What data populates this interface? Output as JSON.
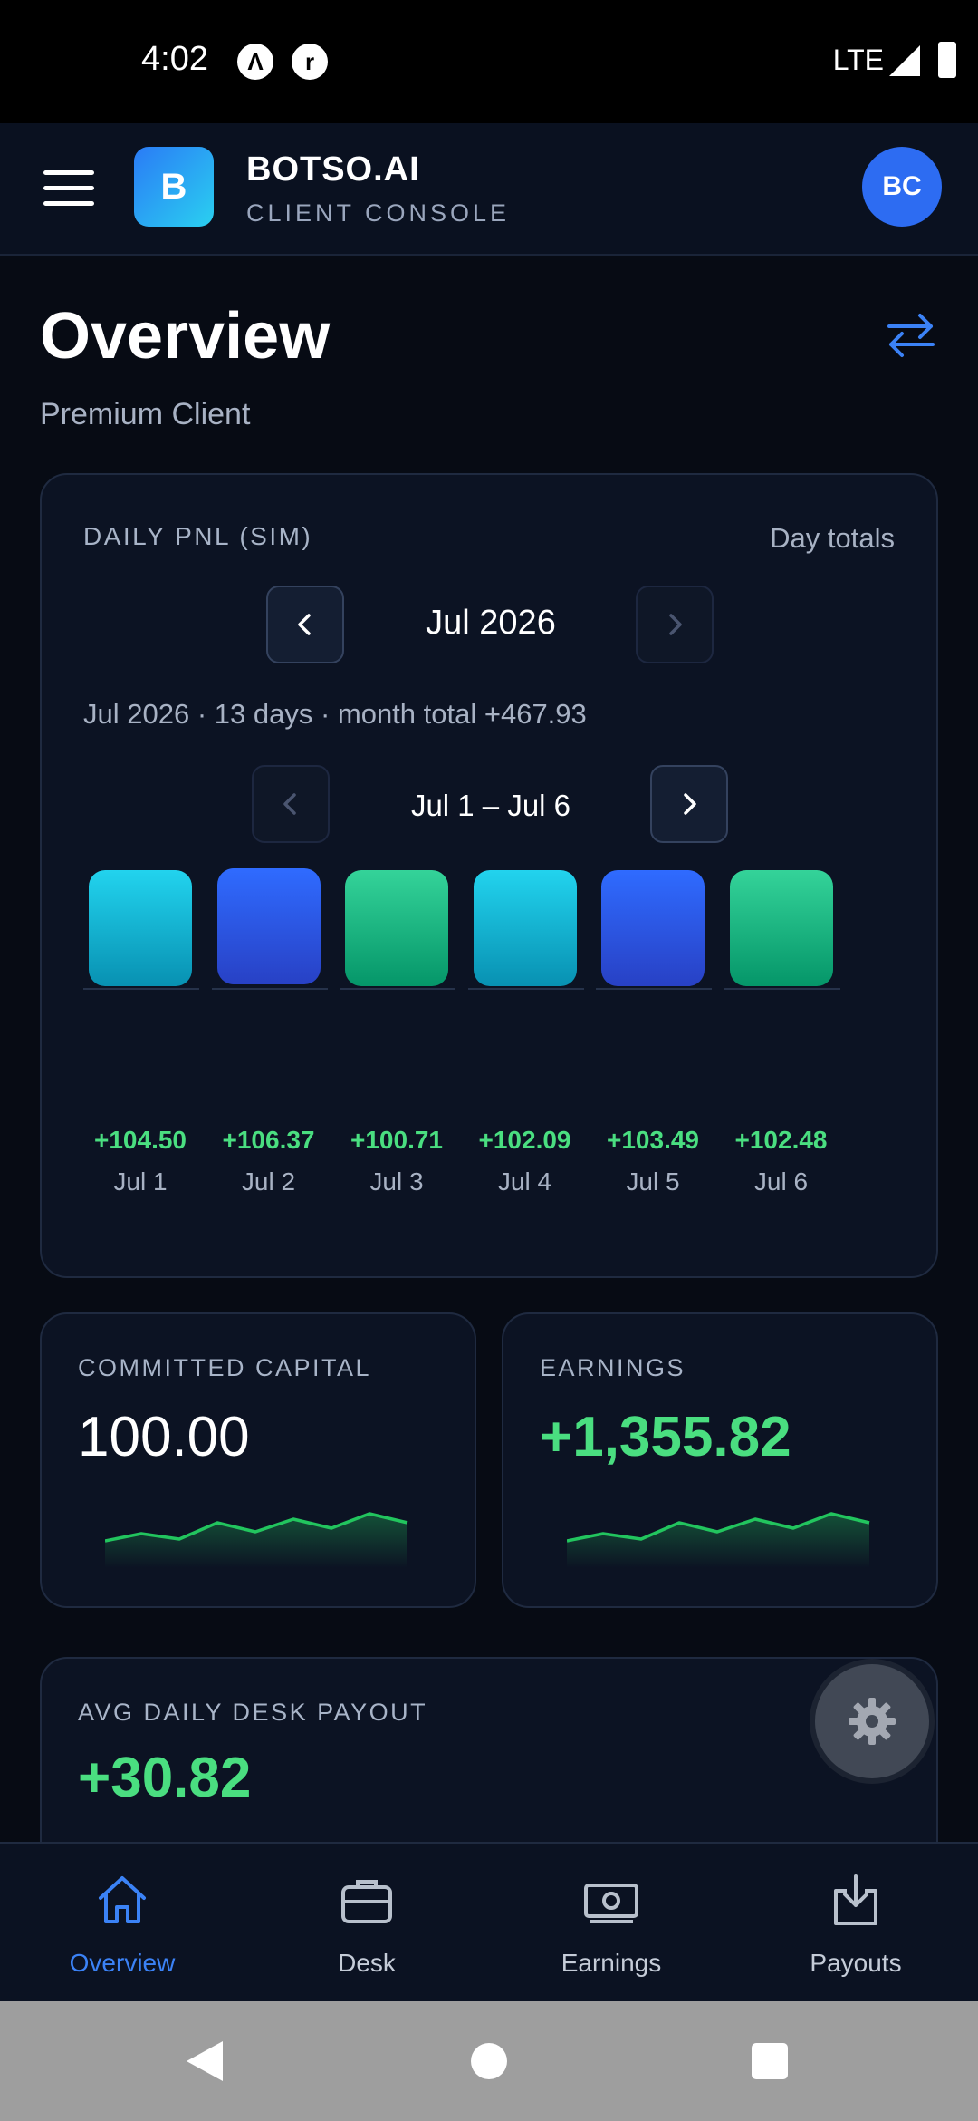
{
  "status_bar": {
    "time": "4:02",
    "network": "LTE"
  },
  "header": {
    "logo_letter": "B",
    "brand": "BOTSO.AI",
    "subtitle": "CLIENT CONSOLE",
    "avatar_initials": "BC"
  },
  "page": {
    "title": "Overview",
    "subtitle": "Premium Client"
  },
  "pnl_card": {
    "label": "DAILY PNL (SIM)",
    "mode": "Day totals",
    "month": "Jul 2026",
    "summary": "Jul 2026 · 13 days · month total +467.93",
    "range": "Jul 1 – Jul 6"
  },
  "chart_data": {
    "type": "bar",
    "categories": [
      "Jul 1",
      "Jul 2",
      "Jul 3",
      "Jul 4",
      "Jul 5",
      "Jul 6"
    ],
    "values": [
      104.5,
      106.37,
      100.71,
      102.09,
      103.49,
      102.48
    ],
    "value_labels": [
      "+104.50",
      "+106.37",
      "+100.71",
      "+102.09",
      "+103.49",
      "+102.48"
    ],
    "bar_colors": [
      "#22d3ee",
      "#2f6bff",
      "#34d399",
      "#22d3ee",
      "#2f6bff",
      "#34d399"
    ]
  },
  "stats": {
    "committed": {
      "label": "COMMITTED CAPITAL",
      "value": "100.00"
    },
    "earnings": {
      "label": "EARNINGS",
      "value": "+1,355.82"
    },
    "avg_payout": {
      "label": "AVG DAILY DESK PAYOUT",
      "value": "+30.82"
    }
  },
  "bottom_nav": [
    {
      "label": "Overview",
      "icon": "home-icon",
      "active": true
    },
    {
      "label": "Desk",
      "icon": "briefcase-icon",
      "active": false
    },
    {
      "label": "Earnings",
      "icon": "banknote-icon",
      "active": false
    },
    {
      "label": "Payouts",
      "icon": "download-icon",
      "active": false
    }
  ],
  "colors": {
    "accent": "#3b82f6",
    "positive": "#4ade80",
    "background": "#070b14"
  }
}
